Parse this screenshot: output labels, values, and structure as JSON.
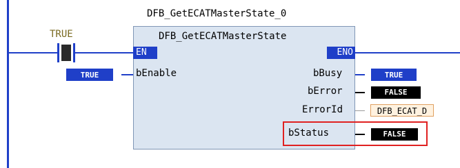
{
  "instance_name": "DFB_GetECATMasterState_0",
  "fb_type": "DFB_GetECATMasterState",
  "contact": {
    "label": "TRUE"
  },
  "inputs": {
    "en": "EN",
    "benable": "bEnable",
    "benable_value": "TRUE"
  },
  "outputs": {
    "eno": "ENO",
    "bbusy": "bBusy",
    "bbusy_value": "TRUE",
    "berror": "bError",
    "berror_value": "FALSE",
    "errorid": "ErrorId",
    "errorid_value": "DFB_ECAT_D",
    "bstatus": "bStatus",
    "bstatus_value": "FALSE"
  },
  "colors": {
    "wire": "#1f3fc8",
    "block_fill": "#dbe5f1",
    "highlight": "#e02020"
  }
}
